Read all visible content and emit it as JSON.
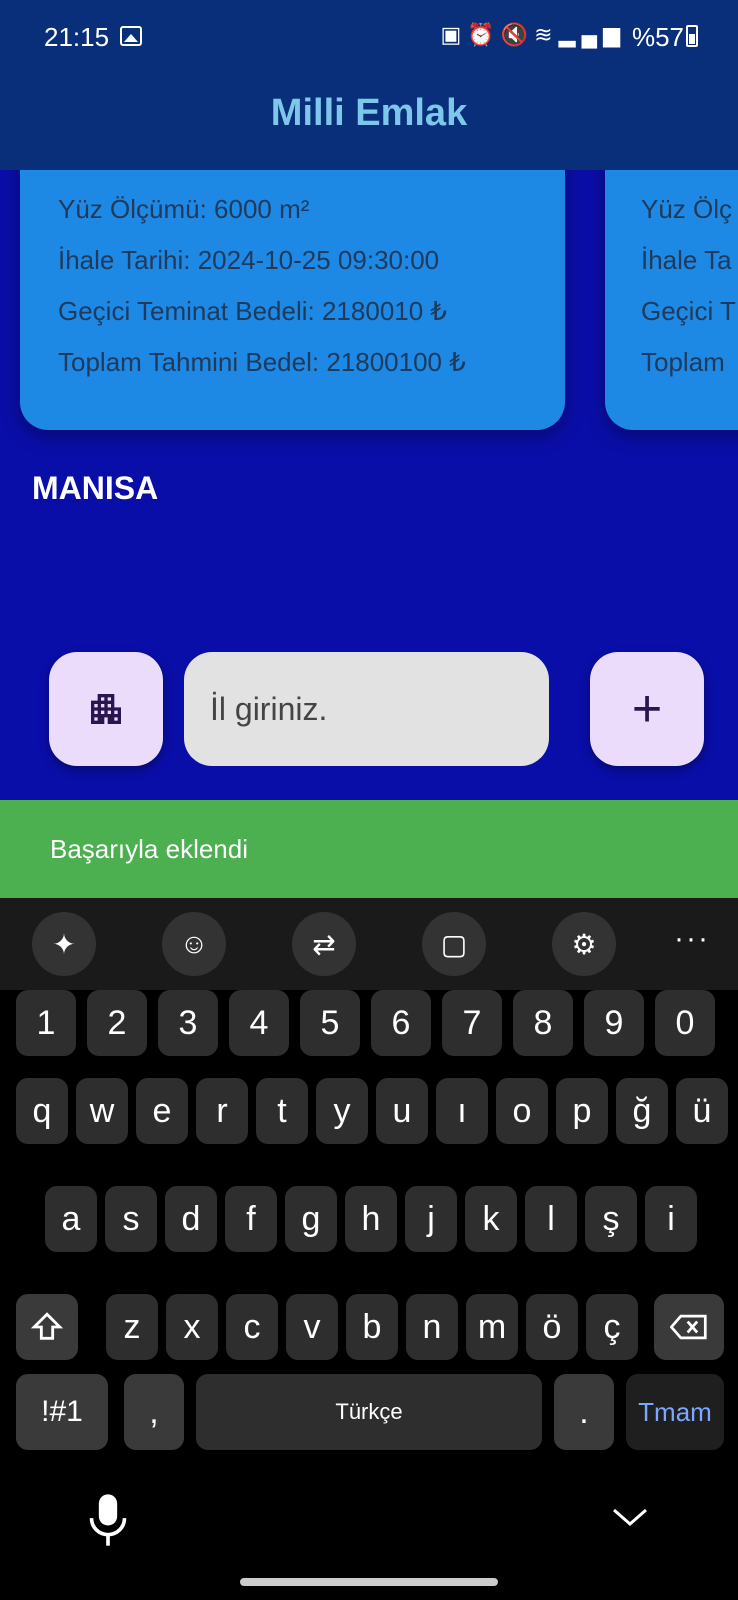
{
  "status_bar": {
    "time": "21:15",
    "icons": [
      "gallery",
      "battery-saver",
      "alarm",
      "mute",
      "wifi",
      "volte",
      "signal"
    ],
    "battery": "%57"
  },
  "app": {
    "title": "Milli Emlak"
  },
  "cards": [
    {
      "area": "Yüz Ölçümü: 6000 m²",
      "date": "İhale Tarihi: 2024-10-25 09:30:00",
      "deposit": "Geçici Teminat Bedeli: 2180010 ₺",
      "total": "Toplam Tahmini Bedel: 21800100 ₺"
    },
    {
      "area": "Yüz Ölç",
      "date": "İhale Ta",
      "deposit": "Geçici T",
      "total": "Toplam"
    }
  ],
  "city_label": "MANISA",
  "input": {
    "placeholder": "İl giriniz."
  },
  "buttons": {
    "add": "+",
    "city_icon": "apartment-icon"
  },
  "snackbar": "Başarıyla eklendi",
  "keyboard": {
    "toolbar": [
      "sparkle",
      "emoji",
      "translate",
      "clipboard",
      "settings",
      "more"
    ],
    "number_row": [
      "1",
      "2",
      "3",
      "4",
      "5",
      "6",
      "7",
      "8",
      "9",
      "0"
    ],
    "row1": [
      "q",
      "w",
      "e",
      "r",
      "t",
      "y",
      "u",
      "ı",
      "o",
      "p",
      "ğ",
      "ü"
    ],
    "row2": [
      "a",
      "s",
      "d",
      "f",
      "g",
      "h",
      "j",
      "k",
      "l",
      "ş",
      "i"
    ],
    "row3": [
      "z",
      "x",
      "c",
      "v",
      "b",
      "n",
      "m",
      "ö",
      "ç"
    ],
    "symbols": "!#1",
    "comma": ",",
    "space": "Türkçe",
    "period": ".",
    "done": "Tmam"
  }
}
